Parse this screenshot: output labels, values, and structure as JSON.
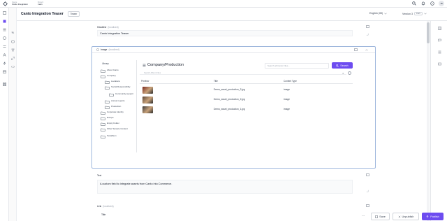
{
  "topbar": {
    "space_label": "Space",
    "space_value": "Canto Integration",
    "env_label": "Branch",
    "env_value": "main",
    "avatar_initials": "JB"
  },
  "doc": {
    "title": "Canto Integration Teaser",
    "badge": "Teaser",
    "language": "English (IM)",
    "version_label": "Version 3",
    "version_badge": "Draft"
  },
  "headline": {
    "label": "Headline",
    "hint": "(localized)",
    "value": "Canto Integration Teaser"
  },
  "image_field": {
    "label": "Image",
    "hint": "(localized)"
  },
  "library": {
    "title": "Library",
    "folders": [
      {
        "name": "About Canto",
        "indent": 0
      },
      {
        "name": "Company",
        "indent": 0
      },
      {
        "name": "Locations",
        "indent": 1
      },
      {
        "name": "Social Responsibility",
        "indent": 1
      },
      {
        "name": "Community support",
        "indent": 2
      },
      {
        "name": "Annual reports",
        "indent": 1
      },
      {
        "name": "Production",
        "indent": 1
      },
      {
        "name": "Corporate Identity",
        "indent": 0
      },
      {
        "name": "Europe",
        "indent": 0
      },
      {
        "name": "Empty Folder",
        "indent": 0
      },
      {
        "name": "Other Sample Content",
        "indent": 0
      },
      {
        "name": "Testalbum",
        "indent": 0
      }
    ]
  },
  "canto": {
    "path": "Company/Production",
    "search_placeholder": "Search all Canto Files...",
    "search_button": "Search",
    "filter_placeholder": "Search Album Files",
    "columns": {
      "preview": "Preview",
      "title": "Title",
      "content_type": "Content Type"
    },
    "rows": [
      {
        "title": "Demo_asset_production_2.jpg",
        "content_type": "image"
      },
      {
        "title": "Demo_asset_production_2.jpg",
        "content_type": "image"
      },
      {
        "title": "Demo_asset_production_1.jpg",
        "content_type": "image"
      }
    ]
  },
  "text_field": {
    "label": "Text",
    "value": "A custom field to integrate assets from Canto into Commerce."
  },
  "link_field": {
    "label": "Link",
    "hint": "(localized)",
    "sub_label": "Title"
  },
  "actions": {
    "save": "Save",
    "unpublish": "Unpublish",
    "publish": "Publish",
    "more": "..."
  },
  "colors": {
    "accent": "#6d4cf0",
    "image_field_border": "#9fb7dd"
  }
}
